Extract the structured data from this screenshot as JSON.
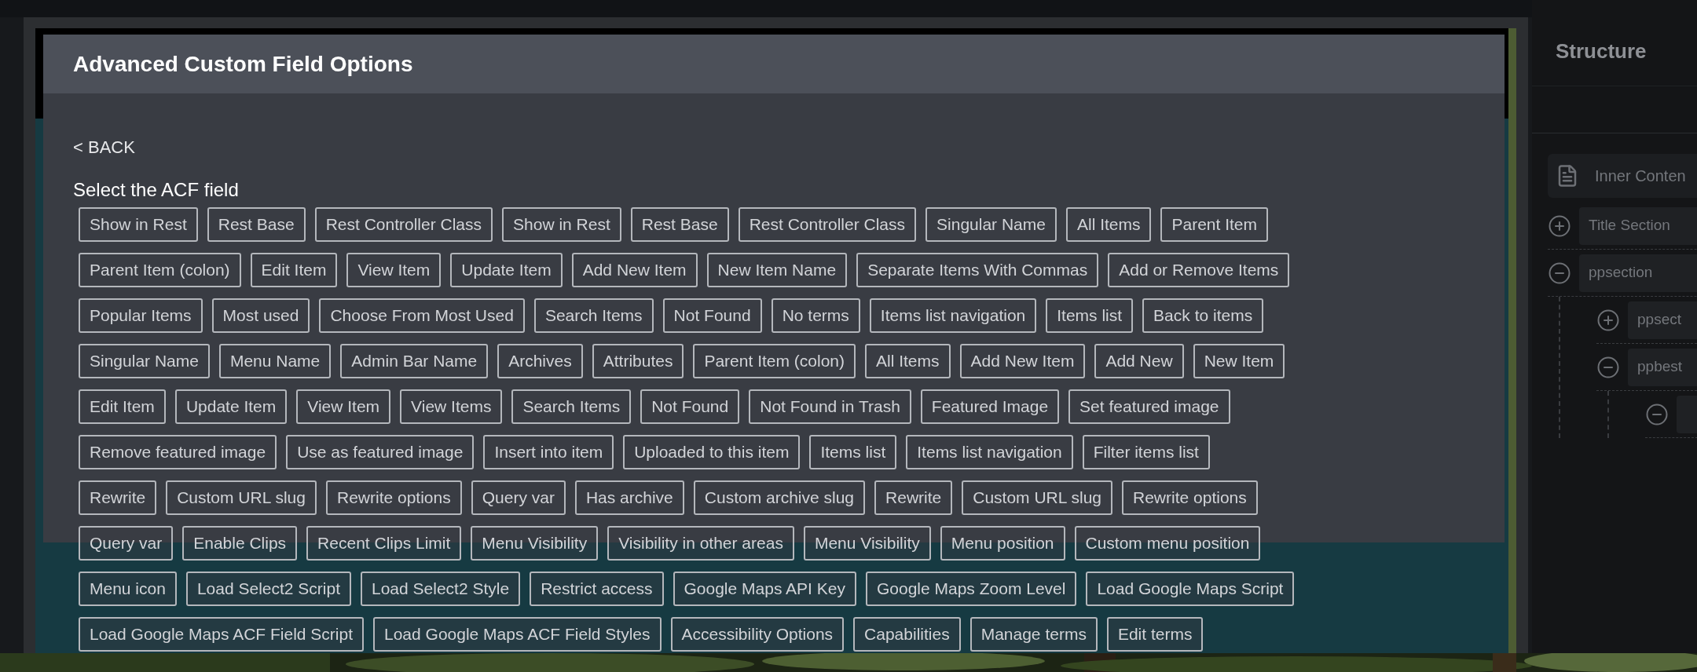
{
  "dialog": {
    "title": "Advanced Custom Field Options",
    "back_link": "< BACK",
    "prompt": "Select the ACF field",
    "field_rows": [
      [
        "Show in Rest",
        "Rest Base",
        "Rest Controller Class",
        "Show in Rest",
        "Rest Base",
        "Rest Controller Class",
        "Singular Name",
        "All Items",
        "Parent Item"
      ],
      [
        "Parent Item (colon)",
        "Edit Item",
        "View Item",
        "Update Item",
        "Add New Item",
        "New Item Name",
        "Separate Items With Commas",
        "Add or Remove Items"
      ],
      [
        "Popular Items",
        "Most used",
        "Choose From Most Used",
        "Search Items",
        "Not Found",
        "No terms",
        "Items list navigation",
        "Items list",
        "Back to items"
      ],
      [
        "Singular Name",
        "Menu Name",
        "Admin Bar Name",
        "Archives",
        "Attributes",
        "Parent Item (colon)",
        "All Items",
        "Add New Item",
        "Add New",
        "New Item"
      ],
      [
        "Edit Item",
        "Update Item",
        "View Item",
        "View Items",
        "Search Items",
        "Not Found",
        "Not Found in Trash",
        "Featured Image",
        "Set featured image"
      ],
      [
        "Remove featured image",
        "Use as featured image",
        "Insert into item",
        "Uploaded to this item",
        "Items list",
        "Items list navigation",
        "Filter items list"
      ],
      [
        "Rewrite",
        "Custom URL slug",
        "Rewrite options",
        "Query var",
        "Has archive",
        "Custom archive slug",
        "Rewrite",
        "Custom URL slug",
        "Rewrite options"
      ],
      [
        "Query var",
        "Enable Clips",
        "Recent Clips Limit",
        "Menu Visibility",
        "Visibility in other areas",
        "Menu Visibility",
        "Menu position",
        "Custom menu position"
      ],
      [
        "Menu icon",
        "Load Select2 Script",
        "Load Select2 Style",
        "Restrict access",
        "Google Maps API Key",
        "Google Maps Zoom Level",
        "Load Google Maps Script"
      ],
      [
        "Load Google Maps ACF Field Script",
        "Load Google Maps ACF Field Styles",
        "Accessibility Options",
        "Capabilities",
        "Manage terms",
        "Edit terms"
      ]
    ]
  },
  "structure_panel": {
    "title": "Structure",
    "items": [
      {
        "kind": "page",
        "label": "Inner Conten"
      },
      {
        "kind": "section",
        "label": "Title Section",
        "expanded": false
      },
      {
        "kind": "section",
        "label": "ppsection",
        "expanded": true,
        "children": [
          {
            "kind": "section",
            "label": "ppsect",
            "expanded": false
          },
          {
            "kind": "section",
            "label": "ppbest",
            "expanded": true,
            "children": [
              {
                "kind": "section",
                "expanded": true
              }
            ]
          }
        ]
      }
    ]
  }
}
